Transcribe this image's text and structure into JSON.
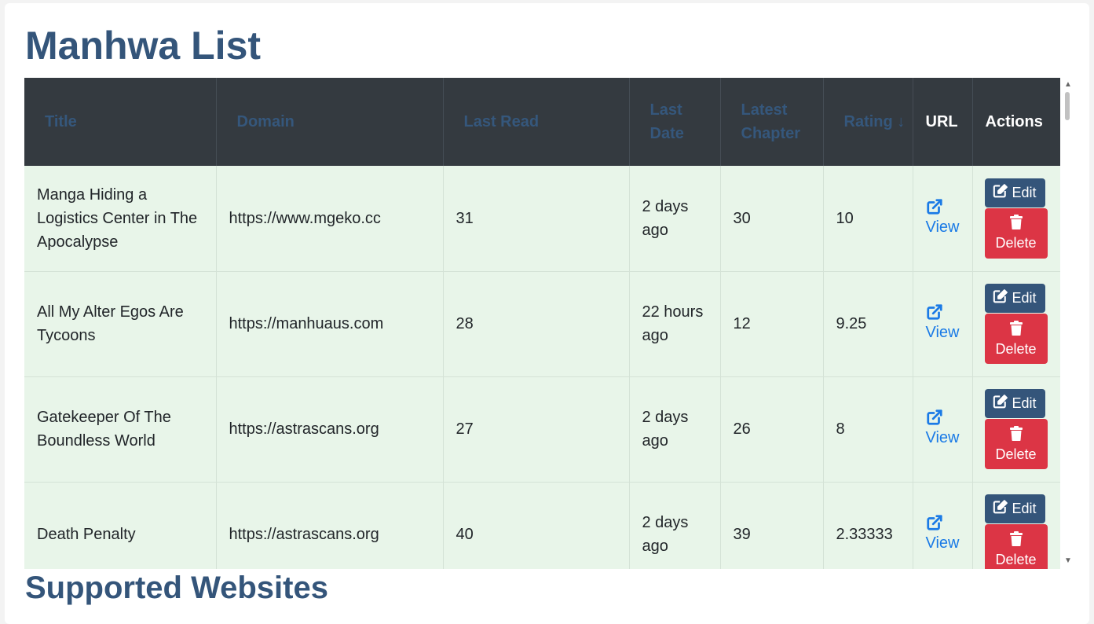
{
  "page": {
    "title": "Manhwa List",
    "section_title": "Supported Websites"
  },
  "table": {
    "headers": [
      "Title",
      "Domain",
      "Last Read",
      "Last Date",
      "Latest Chapter",
      "Rating ↓",
      "URL",
      "Actions"
    ],
    "rows": [
      {
        "title": "Manga Hiding a Logistics Center in The Apocalypse",
        "domain": "https://www.mgeko.cc",
        "last_read": "31",
        "last_date": "2 days ago",
        "latest_chapter": "30",
        "rating": "10",
        "url_label": "View",
        "edit_label": "Edit",
        "delete_label": "Delete"
      },
      {
        "title": "All My Alter Egos Are Tycoons",
        "domain": "https://manhuaus.com",
        "last_read": "28",
        "last_date": "22 hours ago",
        "latest_chapter": "12",
        "rating": "9.25",
        "url_label": "View",
        "edit_label": "Edit",
        "delete_label": "Delete"
      },
      {
        "title": "Gatekeeper Of The Boundless World",
        "domain": "https://astrascans.org",
        "last_read": "27",
        "last_date": "2 days ago",
        "latest_chapter": "26",
        "rating": "8",
        "url_label": "View",
        "edit_label": "Edit",
        "delete_label": "Delete"
      },
      {
        "title": "Death Penalty",
        "domain": "https://astrascans.org",
        "last_read": "40",
        "last_date": "2 days ago",
        "latest_chapter": "39",
        "rating": "2.33333",
        "url_label": "View",
        "edit_label": "Edit",
        "delete_label": "Delete"
      }
    ]
  },
  "colors": {
    "heading": "#34557a",
    "header_bg": "#343a40",
    "row_bg": "#e8f5e9",
    "edit_button": "#34557a",
    "delete_button": "#dc3545",
    "link": "#1a7ae6"
  },
  "icons": {
    "external_link": "external-link-icon",
    "edit": "edit-icon",
    "delete": "trash-icon"
  }
}
